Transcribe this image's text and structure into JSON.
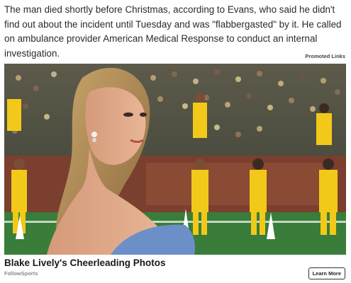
{
  "article": {
    "paragraph": "The man died shortly before Christmas, according to Evans, who said he didn't find out about the incident until Tuesday and was \"flabbergasted\" by it. He called on ambulance provider American Medical Response to conduct an internal investigation."
  },
  "promoted": {
    "label": "Promoted Links"
  },
  "ad": {
    "title": "Blake Lively's Cheerleading Photos",
    "source": "FollowSports",
    "cta_label": "Learn More"
  },
  "colors": {
    "field_green": "#3a7d3a",
    "cheer_yellow": "#f2c919",
    "dress_blue": "#6d8fc8"
  }
}
